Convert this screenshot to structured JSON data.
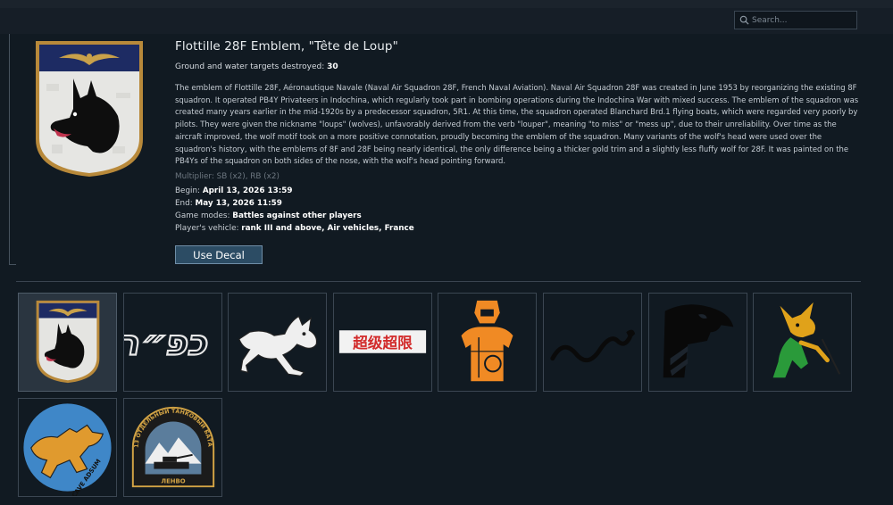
{
  "search": {
    "placeholder": "Search..."
  },
  "decal": {
    "title": "Flottille 28F Emblem, \"Tête de Loup\"",
    "targets_label": "Ground and water targets destroyed:",
    "targets_value": "30",
    "description": "The emblem of Flottille 28F, Aéronautique Navale (Naval Air Squadron 28F, French Naval Aviation). Naval Air Squadron 28F was created in June 1953 by reorganizing the existing 8F squadron. It operated PB4Y Privateers in Indochina, which regularly took part in bombing operations during the Indochina War with mixed success. The emblem of the squadron was created many years earlier in the mid-1920s by a predecessor squadron, 5R1. At this time, the squadron operated Blanchard Brd.1 flying boats, which were regarded very poorly by pilots. They were given the nickname \"loups\" (wolves), unfavorably derived from the verb \"louper\", meaning \"to miss\" or \"mess up\", due to their unreliability. Over time as the aircraft improved, the wolf motif took on a more positive connotation, proudly becoming the emblem of the squadron. Many variants of the wolf's head were used over the squadron's history, with the emblems of 8F and 28F being nearly identical, the only difference being a thicker gold trim and a slightly less fluffy wolf for 28F. It was painted on the PB4Ys of the squadron on both sides of the nose, with the wolf's head pointing forward.",
    "multiplier": "Multiplier: SB (x2), RB (x2)",
    "begin_label": "Begin:",
    "begin_value": "April 13, 2026 13:59",
    "end_label": "End:",
    "end_value": "May 13, 2026 11:59",
    "modes_label": "Game modes:",
    "modes_value": "Battles against other players",
    "vehicle_label": "Player's vehicle:",
    "vehicle_value": "rank III and above, Air vehicles, France",
    "button_label": "Use Decal"
  },
  "decals": [
    {
      "name": "flottille-28f-wolf",
      "selected": true
    },
    {
      "name": "hebrew-letters",
      "text": "כפ״ר"
    },
    {
      "name": "kicking-donkey"
    },
    {
      "name": "chinese-characters",
      "text": "超级超限"
    },
    {
      "name": "orange-warrior"
    },
    {
      "name": "black-snake"
    },
    {
      "name": "eagle-head"
    },
    {
      "name": "green-goblin"
    },
    {
      "name": "cave-adsum-wolf",
      "text": "CAVE ADSUM"
    },
    {
      "name": "tank-battalion",
      "text_top": "13 ОТДЕЛЬНЫЙ ТАНКОВЫЙ БАТАЛЬОН",
      "text_bottom": "ЛЕНВО"
    }
  ],
  "colors": {
    "accent_button": "#2c4c64",
    "background": "#111a22",
    "selected_tile": "#2a3540"
  }
}
